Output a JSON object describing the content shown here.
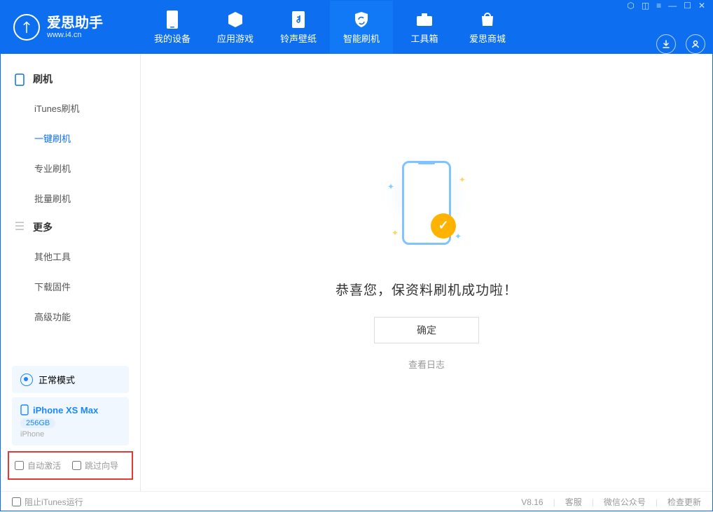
{
  "app": {
    "title": "爱思助手",
    "subtitle": "www.i4.cn"
  },
  "tabs": [
    {
      "label": "我的设备"
    },
    {
      "label": "应用游戏"
    },
    {
      "label": "铃声壁纸"
    },
    {
      "label": "智能刷机"
    },
    {
      "label": "工具箱"
    },
    {
      "label": "爱思商城"
    }
  ],
  "sidebar": {
    "group1": {
      "header": "刷机",
      "items": [
        "iTunes刷机",
        "一键刷机",
        "专业刷机",
        "批量刷机"
      ]
    },
    "group2": {
      "header": "更多",
      "items": [
        "其他工具",
        "下载固件",
        "高级功能"
      ]
    }
  },
  "mode": {
    "label": "正常模式"
  },
  "device": {
    "name": "iPhone XS Max",
    "capacity": "256GB",
    "type": "iPhone"
  },
  "checks": {
    "auto_activate": "自动激活",
    "skip_guide": "跳过向导"
  },
  "main": {
    "success": "恭喜您，保资料刷机成功啦！",
    "ok": "确定",
    "log": "查看日志"
  },
  "status": {
    "block_itunes": "阻止iTunes运行",
    "version": "V8.16",
    "service": "客服",
    "wechat": "微信公众号",
    "update": "检查更新"
  }
}
